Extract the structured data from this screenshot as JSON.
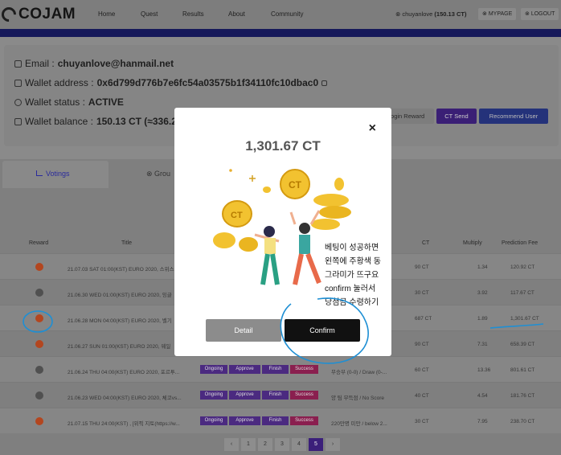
{
  "brand": {
    "name": "COJAM"
  },
  "nav": {
    "items": [
      "Home",
      "Quest",
      "Results",
      "About",
      "Community"
    ]
  },
  "user": {
    "chip": "chuyanlove",
    "balance": "(150.13 CT)",
    "mypage": "MYPAGE",
    "logout": "LOGOUT"
  },
  "profile": {
    "email_label": "Email :",
    "email": "chuyanlove@hanmail.net",
    "wallet_label": "Wallet address :",
    "wallet": "0x6d799d776b7e6fc54a03575b1f34110fc10dbac0",
    "status_label": "Wallet status :",
    "status": "ACTIVE",
    "balance_label": "Wallet balance :",
    "balance": "150.13 CT (≈336.2",
    "buttons": {
      "login_reward": "Login Reward",
      "ct_send": "CT Send",
      "recommend": "Recommend User"
    }
  },
  "tabs": {
    "voting": "Votings",
    "group": "Grou"
  },
  "table": {
    "headers": {
      "reward": "Reward",
      "title": "Title",
      "ct": "CT",
      "multiply": "Multiply",
      "fee": "Prediction Fee"
    },
    "rows": [
      {
        "dot": "orange",
        "title": "21.07.03 SAT 01:00(KST) EURO 2020, 스위스",
        "status": "",
        "answer": "",
        "ct": "90 CT",
        "multiply": "1.34",
        "fee": "120.92 CT"
      },
      {
        "dot": "gray",
        "title": "21.06.30 WED 01:00(KST) EURO 2020, 잉글",
        "status": "",
        "answer": "",
        "ct": "30 CT",
        "multiply": "3.92",
        "fee": "117.67 CT"
      },
      {
        "dot": "orange",
        "title": "21.06.28 MON 04:00(KST) EURO 2020, 벨기",
        "status": "",
        "answer": "",
        "ct": "687 CT",
        "multiply": "1.89",
        "fee": "1,301.67 CT"
      },
      {
        "dot": "orange",
        "title": "21.06.27 SUN 01:00(KST) EURO 2020, 웨일",
        "status": "",
        "answer": "",
        "ct": "90 CT",
        "multiply": "7.31",
        "fee": "658.39 CT"
      },
      {
        "dot": "gray",
        "title": "21.06.24 THU 04:00(KST) EURO 2020, 포르투...",
        "status": "pills",
        "answer": "무승부 (0-0) / Draw (0-...",
        "ct": "60 CT",
        "multiply": "13.36",
        "fee": "801.61 CT"
      },
      {
        "dot": "gray",
        "title": "21.06.23 WED 04:00(KST) EURO 2020, 체코vs...",
        "status": "pills",
        "answer": "양 팀 무득점 / No Score",
        "ct": "40 CT",
        "multiply": "4.54",
        "fee": "181.76 CT"
      },
      {
        "dot": "orange",
        "title": "21.07.15 THU 24:00(KST) , [위픽 지토(https://w...",
        "status": "pills",
        "answer": "220만명 미만 / below 2...",
        "ct": "30 CT",
        "multiply": "7.95",
        "fee": "238.70 CT"
      }
    ],
    "pills": [
      "Ongoing",
      "Approve",
      "Finish",
      "Success"
    ]
  },
  "pagination": {
    "prev": "‹",
    "pages": [
      "1",
      "2",
      "3",
      "4",
      "5"
    ],
    "next": "›",
    "current": "5"
  },
  "modal": {
    "amount": "1,301.67 CT",
    "detail": "Detail",
    "confirm": "Confirm",
    "close": "×"
  },
  "annotation": {
    "lines": [
      "베팅이 성공하면",
      "왼쪽에 주황색 동",
      "그라미가 뜨구요",
      "confirm 눌러서",
      "당첨금 수령하기"
    ]
  },
  "colors": {
    "accent": "#3b1f7a",
    "annotation": "#1e8fd4",
    "coin": "#f2c230"
  }
}
